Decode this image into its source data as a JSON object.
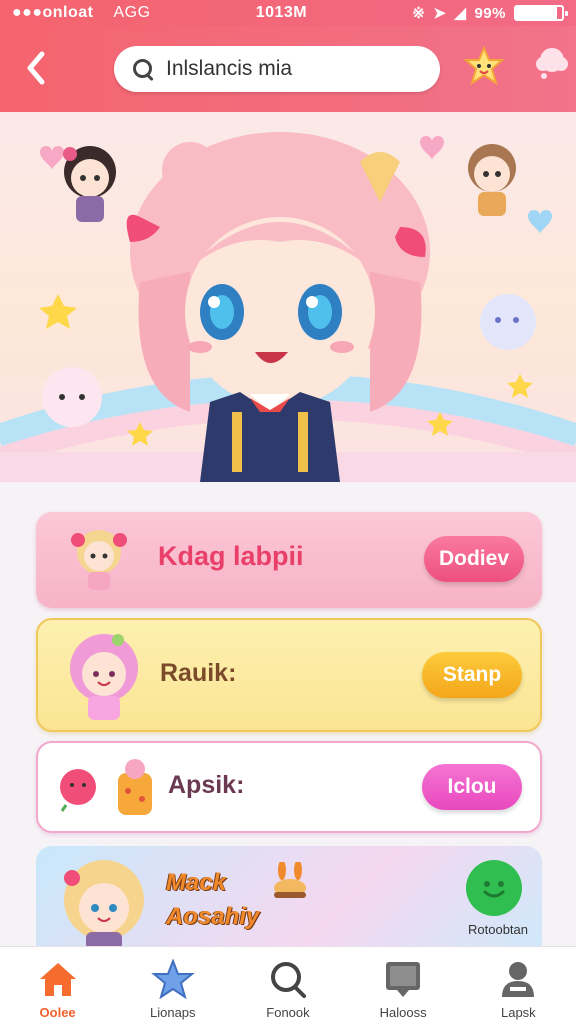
{
  "status_bar": {
    "carrier": "●●●onloat",
    "network": "AGG",
    "time": "1013M",
    "battery": "99%",
    "battery_level": 0.9
  },
  "header": {
    "back_icon": "chevron-left-icon",
    "search": {
      "value": "Inlslancis mia"
    },
    "mascot_icon": "star-mascot-icon",
    "bubble_icon": "chat-bubble-icon"
  },
  "banner": {
    "description": "chibi girl hero banner"
  },
  "cards": [
    {
      "title": "Kdag labpii",
      "button": "Dodiev",
      "accent": "#ee4f7e"
    },
    {
      "title": "Rauik:",
      "button": "Stanp",
      "accent": "#f4a61a"
    },
    {
      "title": "Apsik:",
      "button": "Iclou",
      "accent": "#e848be"
    },
    {
      "title_line1": "Mack",
      "title_line2": "Aosahiy",
      "chat_label": "Rotoobtan"
    }
  ],
  "bottom_nav": [
    {
      "label": "Oolee",
      "icon": "home-icon",
      "active": true
    },
    {
      "label": "Lionaps",
      "icon": "star-icon",
      "active": false
    },
    {
      "label": "Fonook",
      "icon": "search-icon",
      "active": false
    },
    {
      "label": "Halooss",
      "icon": "message-icon",
      "active": false
    },
    {
      "label": "Lapsk",
      "icon": "profile-icon",
      "active": false
    }
  ],
  "colors": {
    "header": "#f4646e",
    "active_nav": "#f2602e"
  }
}
